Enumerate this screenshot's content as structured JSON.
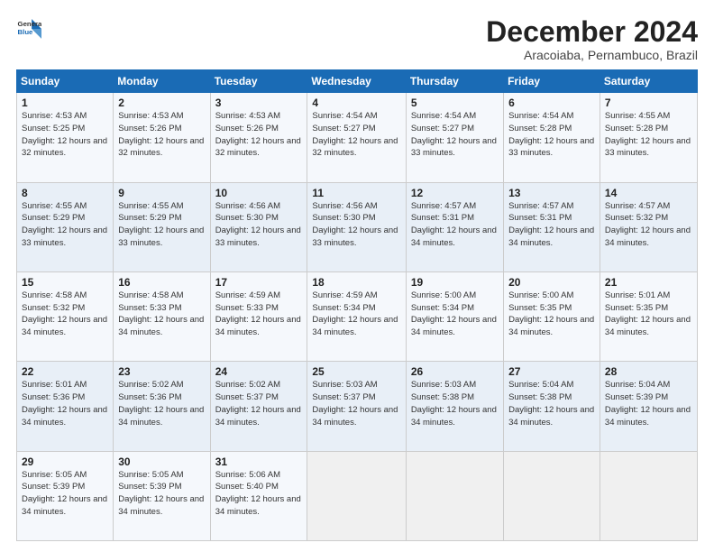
{
  "logo": {
    "line1": "General",
    "line2": "Blue"
  },
  "title": "December 2024",
  "subtitle": "Aracoiaba, Pernambuco, Brazil",
  "days_of_week": [
    "Sunday",
    "Monday",
    "Tuesday",
    "Wednesday",
    "Thursday",
    "Friday",
    "Saturday"
  ],
  "weeks": [
    [
      {
        "day": "1",
        "sunrise": "4:53 AM",
        "sunset": "5:25 PM",
        "daylight": "12 hours and 32 minutes."
      },
      {
        "day": "2",
        "sunrise": "4:53 AM",
        "sunset": "5:26 PM",
        "daylight": "12 hours and 32 minutes."
      },
      {
        "day": "3",
        "sunrise": "4:53 AM",
        "sunset": "5:26 PM",
        "daylight": "12 hours and 32 minutes."
      },
      {
        "day": "4",
        "sunrise": "4:54 AM",
        "sunset": "5:27 PM",
        "daylight": "12 hours and 32 minutes."
      },
      {
        "day": "5",
        "sunrise": "4:54 AM",
        "sunset": "5:27 PM",
        "daylight": "12 hours and 33 minutes."
      },
      {
        "day": "6",
        "sunrise": "4:54 AM",
        "sunset": "5:28 PM",
        "daylight": "12 hours and 33 minutes."
      },
      {
        "day": "7",
        "sunrise": "4:55 AM",
        "sunset": "5:28 PM",
        "daylight": "12 hours and 33 minutes."
      }
    ],
    [
      {
        "day": "8",
        "sunrise": "4:55 AM",
        "sunset": "5:29 PM",
        "daylight": "12 hours and 33 minutes."
      },
      {
        "day": "9",
        "sunrise": "4:55 AM",
        "sunset": "5:29 PM",
        "daylight": "12 hours and 33 minutes."
      },
      {
        "day": "10",
        "sunrise": "4:56 AM",
        "sunset": "5:30 PM",
        "daylight": "12 hours and 33 minutes."
      },
      {
        "day": "11",
        "sunrise": "4:56 AM",
        "sunset": "5:30 PM",
        "daylight": "12 hours and 33 minutes."
      },
      {
        "day": "12",
        "sunrise": "4:57 AM",
        "sunset": "5:31 PM",
        "daylight": "12 hours and 34 minutes."
      },
      {
        "day": "13",
        "sunrise": "4:57 AM",
        "sunset": "5:31 PM",
        "daylight": "12 hours and 34 minutes."
      },
      {
        "day": "14",
        "sunrise": "4:57 AM",
        "sunset": "5:32 PM",
        "daylight": "12 hours and 34 minutes."
      }
    ],
    [
      {
        "day": "15",
        "sunrise": "4:58 AM",
        "sunset": "5:32 PM",
        "daylight": "12 hours and 34 minutes."
      },
      {
        "day": "16",
        "sunrise": "4:58 AM",
        "sunset": "5:33 PM",
        "daylight": "12 hours and 34 minutes."
      },
      {
        "day": "17",
        "sunrise": "4:59 AM",
        "sunset": "5:33 PM",
        "daylight": "12 hours and 34 minutes."
      },
      {
        "day": "18",
        "sunrise": "4:59 AM",
        "sunset": "5:34 PM",
        "daylight": "12 hours and 34 minutes."
      },
      {
        "day": "19",
        "sunrise": "5:00 AM",
        "sunset": "5:34 PM",
        "daylight": "12 hours and 34 minutes."
      },
      {
        "day": "20",
        "sunrise": "5:00 AM",
        "sunset": "5:35 PM",
        "daylight": "12 hours and 34 minutes."
      },
      {
        "day": "21",
        "sunrise": "5:01 AM",
        "sunset": "5:35 PM",
        "daylight": "12 hours and 34 minutes."
      }
    ],
    [
      {
        "day": "22",
        "sunrise": "5:01 AM",
        "sunset": "5:36 PM",
        "daylight": "12 hours and 34 minutes."
      },
      {
        "day": "23",
        "sunrise": "5:02 AM",
        "sunset": "5:36 PM",
        "daylight": "12 hours and 34 minutes."
      },
      {
        "day": "24",
        "sunrise": "5:02 AM",
        "sunset": "5:37 PM",
        "daylight": "12 hours and 34 minutes."
      },
      {
        "day": "25",
        "sunrise": "5:03 AM",
        "sunset": "5:37 PM",
        "daylight": "12 hours and 34 minutes."
      },
      {
        "day": "26",
        "sunrise": "5:03 AM",
        "sunset": "5:38 PM",
        "daylight": "12 hours and 34 minutes."
      },
      {
        "day": "27",
        "sunrise": "5:04 AM",
        "sunset": "5:38 PM",
        "daylight": "12 hours and 34 minutes."
      },
      {
        "day": "28",
        "sunrise": "5:04 AM",
        "sunset": "5:39 PM",
        "daylight": "12 hours and 34 minutes."
      }
    ],
    [
      {
        "day": "29",
        "sunrise": "5:05 AM",
        "sunset": "5:39 PM",
        "daylight": "12 hours and 34 minutes."
      },
      {
        "day": "30",
        "sunrise": "5:05 AM",
        "sunset": "5:39 PM",
        "daylight": "12 hours and 34 minutes."
      },
      {
        "day": "31",
        "sunrise": "5:06 AM",
        "sunset": "5:40 PM",
        "daylight": "12 hours and 34 minutes."
      },
      null,
      null,
      null,
      null
    ]
  ]
}
